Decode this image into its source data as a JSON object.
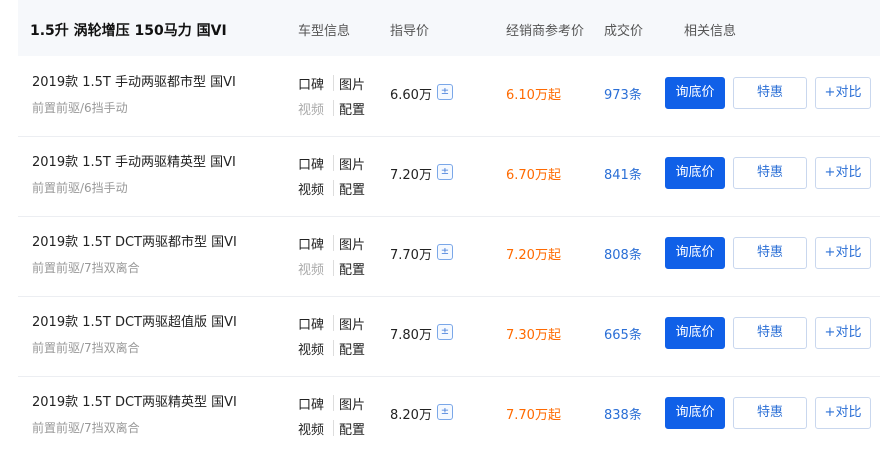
{
  "header": {
    "title": "1.5升 涡轮增压 150马力 国VI",
    "columns": [
      "车型信息",
      "指导价",
      "经销商参考价",
      "成交价",
      "相关信息"
    ]
  },
  "links": {
    "review": "口碑",
    "photo": "图片",
    "video": "视频",
    "config": "配置"
  },
  "buttons": {
    "inquire": "询底价",
    "sale": "特惠",
    "compare": "+对比"
  },
  "calc_icon": "calculator-icon",
  "rows": [
    {
      "name": "2019款 1.5T 手动两驱都市型 国VI",
      "spec": "前置前驱/6挡手动",
      "guide_price": "6.60万",
      "dealer_price": "6.10万起",
      "deals": "973条",
      "video_available": false
    },
    {
      "name": "2019款 1.5T 手动两驱精英型 国VI",
      "spec": "前置前驱/6挡手动",
      "guide_price": "7.20万",
      "dealer_price": "6.70万起",
      "deals": "841条",
      "video_available": true
    },
    {
      "name": "2019款 1.5T DCT两驱都市型 国VI",
      "spec": "前置前驱/7挡双离合",
      "guide_price": "7.70万",
      "dealer_price": "7.20万起",
      "deals": "808条",
      "video_available": false
    },
    {
      "name": "2019款 1.5T DCT两驱超值版 国VI",
      "spec": "前置前驱/7挡双离合",
      "guide_price": "7.80万",
      "dealer_price": "7.30万起",
      "deals": "665条",
      "video_available": true
    },
    {
      "name": "2019款 1.5T DCT两驱精英型 国VI",
      "spec": "前置前驱/7挡双离合",
      "guide_price": "8.20万",
      "dealer_price": "7.70万起",
      "deals": "838条",
      "video_available": true
    }
  ]
}
